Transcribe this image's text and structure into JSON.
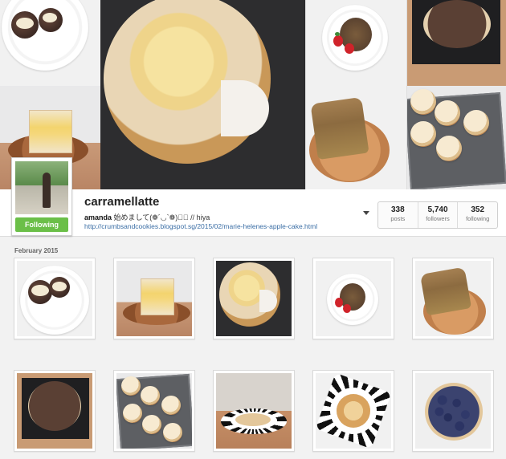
{
  "profile": {
    "username": "carramellatte",
    "display_name": "amanda",
    "bio_text": "始めまして(❁´◡`❁)✲ﾟ // hiya",
    "website": "http://crumbsandcookies.blogspot.sg/2015/02/marie-helenes-apple-cake.html",
    "follow_button_label": "Following",
    "follow_button_color": "#6bbf48"
  },
  "stats": [
    {
      "value": "338",
      "label": "posts"
    },
    {
      "value": "5,740",
      "label": "followers"
    },
    {
      "value": "352",
      "label": "following"
    }
  ],
  "section_label": "February 2015",
  "hero_photos": [
    {
      "name": "cookie-sandwich-plate"
    },
    {
      "name": "apple-cake-large"
    },
    {
      "name": "cookie-strawberries"
    },
    {
      "name": "chocolate-tart-tray"
    },
    {
      "name": "cake-slice"
    },
    {
      "name": "banana-loaf"
    },
    {
      "name": "cupcakes-tray"
    }
  ],
  "grid_photos": [
    {
      "name": "cookie-sandwich-plate"
    },
    {
      "name": "cake-slice"
    },
    {
      "name": "apple-cake"
    },
    {
      "name": "cookie-strawberries"
    },
    {
      "name": "banana-loaf"
    },
    {
      "name": "chocolate-tart-tray"
    },
    {
      "name": "cupcakes-tray"
    },
    {
      "name": "cake-on-striped-plate"
    },
    {
      "name": "pastry-on-striped-plate"
    },
    {
      "name": "blueberry-tart"
    }
  ]
}
